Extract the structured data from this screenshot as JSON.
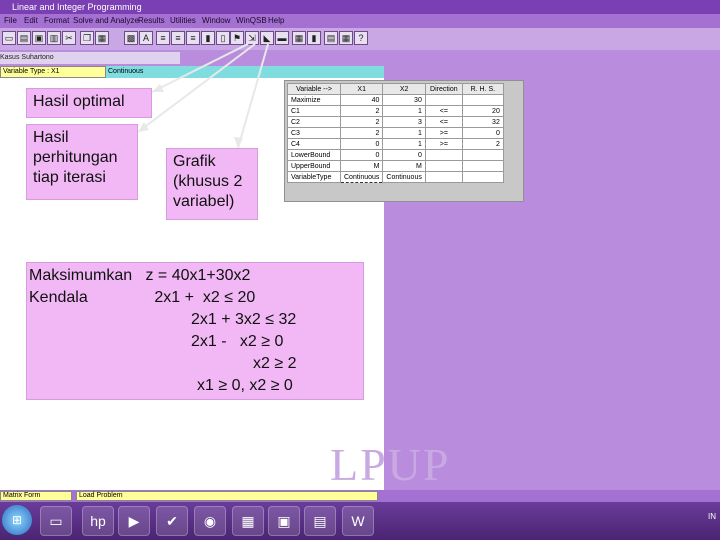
{
  "window": {
    "title": "Linear and Integer Programming"
  },
  "menu": [
    "File",
    "Edit",
    "Format",
    "Solve and Analyze",
    "Results",
    "Utilities",
    "Window",
    "WinQSB",
    "Help"
  ],
  "toolbar_icons": [
    "new-file-icon",
    "open-file-icon",
    "save-icon",
    "print-icon",
    "cut-icon",
    "copy-icon",
    "paste-icon",
    "font-icon",
    "align-left-icon",
    "align-center-icon",
    "align-right-icon",
    "solve-icon",
    "iteration-icon",
    "graph-icon",
    "table-icon",
    "chart-icon",
    "calculator-icon",
    "help-icon"
  ],
  "document": {
    "subwindow_title": "Kasus Suhartono",
    "variable_type_label": "Variable Type : X1",
    "variable_type_value": "Continuous"
  },
  "callouts": {
    "optimal": "Hasil optimal",
    "iteration": "Hasil perhitungan tiap iterasi",
    "graph": "Grafik (khusus 2 variabel)"
  },
  "matrix": {
    "headers": [
      "Variable -->",
      "X1",
      "X2",
      "Direction",
      "R. H. S."
    ],
    "rows": [
      [
        "Maximize",
        "40",
        "30",
        "",
        ""
      ],
      [
        "C1",
        "2",
        "1",
        "<=",
        "20"
      ],
      [
        "C2",
        "2",
        "3",
        "<=",
        "32"
      ],
      [
        "C3",
        "2",
        "1",
        ">=",
        "0"
      ],
      [
        "C4",
        "0",
        "1",
        ">=",
        "2"
      ],
      [
        "LowerBound",
        "0",
        "0",
        "",
        ""
      ],
      [
        "UpperBound",
        "M",
        "M",
        "",
        ""
      ],
      [
        "VariableType",
        "Continuous",
        "Continuous",
        "",
        ""
      ]
    ]
  },
  "model": {
    "line1": "Maksimumkan   z = 40x1+30x2",
    "line2": "Kendala               2x1 +  x2 ≤ 20",
    "line3": "2x1 + 3x2 ≤ 32",
    "line4": "2x1 -   x2 ≥ 0",
    "line5": "x2 ≥ 2",
    "line6": "x1 ≥ 0, x2 ≥ 0"
  },
  "watermark": "LPUP",
  "status": {
    "left": "Matrix Form",
    "right": "Load Problem"
  },
  "tray": "IN",
  "colors": {
    "accent": "#7b3fb4",
    "callout": "#f2b8f5",
    "arrow": "#e8e8e8"
  }
}
